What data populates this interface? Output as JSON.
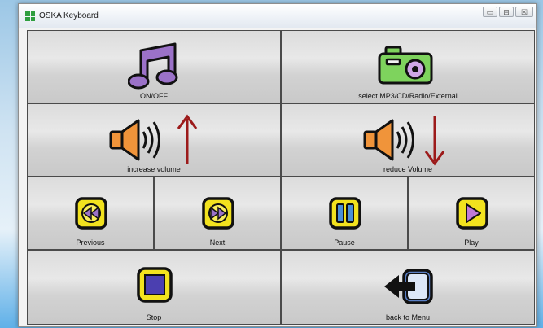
{
  "window": {
    "title": "OSKA Keyboard",
    "controls": {
      "minimize": "▭",
      "maximize": "⊟",
      "close": "☒"
    }
  },
  "buttons": {
    "on_off": {
      "label": "ON/OFF",
      "icon": "music-notes-icon"
    },
    "select_source": {
      "label": "select MP3/CD/Radio/External",
      "icon": "camera-icon"
    },
    "increase_volume": {
      "label": "increase volume",
      "icon": "speaker-up-arrow-icon"
    },
    "reduce_volume": {
      "label": "reduce Volume",
      "icon": "speaker-down-arrow-icon"
    },
    "previous": {
      "label": "Previous",
      "icon": "rewind-icon"
    },
    "next": {
      "label": "Next",
      "icon": "fast-forward-icon"
    },
    "pause": {
      "label": "Pause",
      "icon": "pause-icon"
    },
    "play": {
      "label": "Play",
      "icon": "play-icon"
    },
    "stop": {
      "label": "Stop",
      "icon": "stop-icon"
    },
    "back_to_menu": {
      "label": "back to Menu",
      "icon": "back-arrow-icon"
    }
  },
  "colors": {
    "accent_yellow": "#f2e21e",
    "music_purple": "#9b72c8",
    "speaker_orange": "#f0943a",
    "camera_green": "#7ed35d",
    "arrow_red": "#9c1a1a",
    "stop_blue": "#4b3fb0",
    "back_blue": "#5a7fc4"
  }
}
